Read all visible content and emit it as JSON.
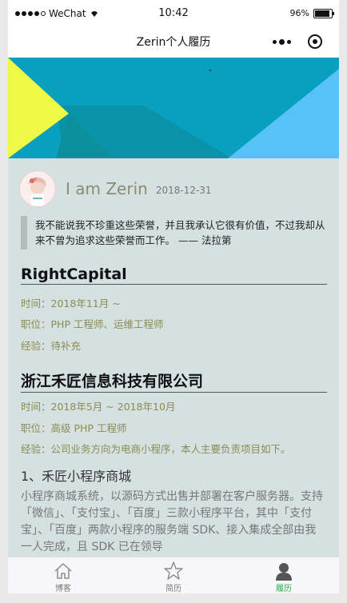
{
  "status": {
    "carrier": "WeChat",
    "time": "10:42",
    "battery": "96%"
  },
  "nav": {
    "title": "Zerin个人履历"
  },
  "profile": {
    "name": "I am Zerin",
    "date": "2018-12-31"
  },
  "quote": "我不能说我不珍重这些荣誉，并且我承认它很有价值，不过我却从来不曾为追求这些荣誉而工作。 —— 法拉第",
  "jobs": [
    {
      "company": "RightCapital",
      "time_label": "时间：",
      "time": "2018年11月 ~",
      "role_label": "职位：",
      "role": "PHP 工程师、运维工程师",
      "exp_label": "经验：",
      "exp": "待补充"
    },
    {
      "company": "浙江禾匠信息科技有限公司",
      "time_label": "时间：",
      "time": "2018年5月 ~ 2018年10月",
      "role_label": "职位：",
      "role": "高级 PHP 工程师",
      "exp_label": "经验：",
      "exp": "公司业务方向为电商小程序，本人主要负责项目如下。"
    }
  ],
  "project": {
    "title": "1、禾匠小程序商城",
    "desc": "小程序商城系统，以源码方式出售并部署在客户服务器。支持「微信」、「支付宝」、「百度」三款小程序平台，其中「支付宝」、「百度」两款小程序的服务端 SDK、接入集成全部由我一人完成，且 SDK 已在领导"
  },
  "tabs": [
    {
      "label": "博客",
      "icon": "home-icon",
      "active": false
    },
    {
      "label": "简历",
      "icon": "star-icon",
      "active": false
    },
    {
      "label": "履历",
      "icon": "person-icon",
      "active": true
    }
  ],
  "colors": {
    "accent": "#26a947",
    "content_bg": "#d5e0e1",
    "info_text": "#8a8c54"
  }
}
